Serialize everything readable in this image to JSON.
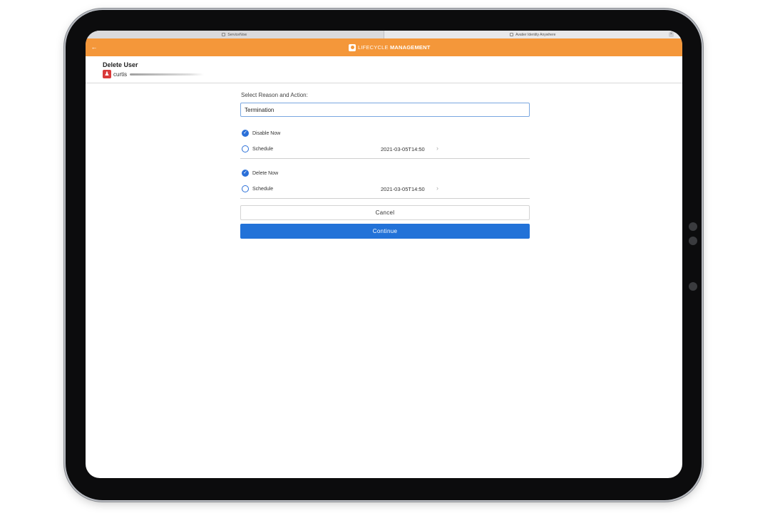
{
  "browser": {
    "tabs": [
      {
        "label": "ServiceNow",
        "active": false
      },
      {
        "label": "Avatier Identity Anywhere",
        "active": true
      }
    ],
    "close_icon": "×"
  },
  "app": {
    "back_icon": "arrow-left-icon",
    "brand_light": "LIFECYCLE",
    "brand_bold": "MANAGEMENT",
    "accent_color": "#f4973a"
  },
  "header": {
    "title": "Delete User",
    "user_name": "curtis"
  },
  "form": {
    "reason_label": "Select Reason and Action:",
    "reason_value": "Termination",
    "disable_group": {
      "now_label": "Disable Now",
      "now_selected": true,
      "schedule_label": "Schedule",
      "schedule_selected": false,
      "schedule_date": "2021-03-05T14:50"
    },
    "delete_group": {
      "now_label": "Delete Now",
      "now_selected": true,
      "schedule_label": "Schedule",
      "schedule_selected": false,
      "schedule_date": "2021-03-05T14:50"
    },
    "cancel_label": "Cancel",
    "continue_label": "Continue",
    "primary_color": "#2272d8"
  }
}
